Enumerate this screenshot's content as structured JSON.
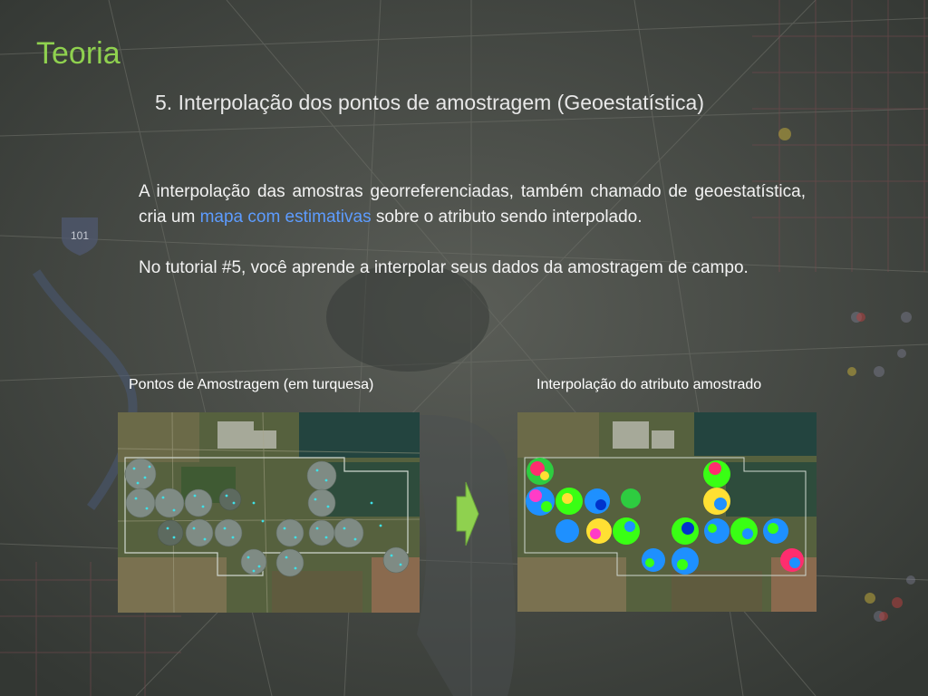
{
  "slide": {
    "section_title": "Teoria",
    "subtitle": "5. Interpolação dos pontos de amostragem (Geoestatística)",
    "paragraph1_before": "A interpolação das amostras georreferenciadas, também chamado de geoestatística, cria um ",
    "paragraph1_highlight": "mapa com estimativas",
    "paragraph1_after": " sobre o atributo sendo interpolado.",
    "paragraph2": "No tutorial #5, você aprende a interpolar seus dados da amostragem de campo.",
    "highway_shield": "101"
  },
  "figures": {
    "left_caption": "Pontos de Amostragem (em  turquesa)",
    "right_caption": "Interpolação do atributo amostrado"
  },
  "colors": {
    "title": "#8fd14f",
    "highlight": "#5d9cff",
    "sample_points": "#3fe0e6",
    "arrow": "#8fd14f"
  }
}
